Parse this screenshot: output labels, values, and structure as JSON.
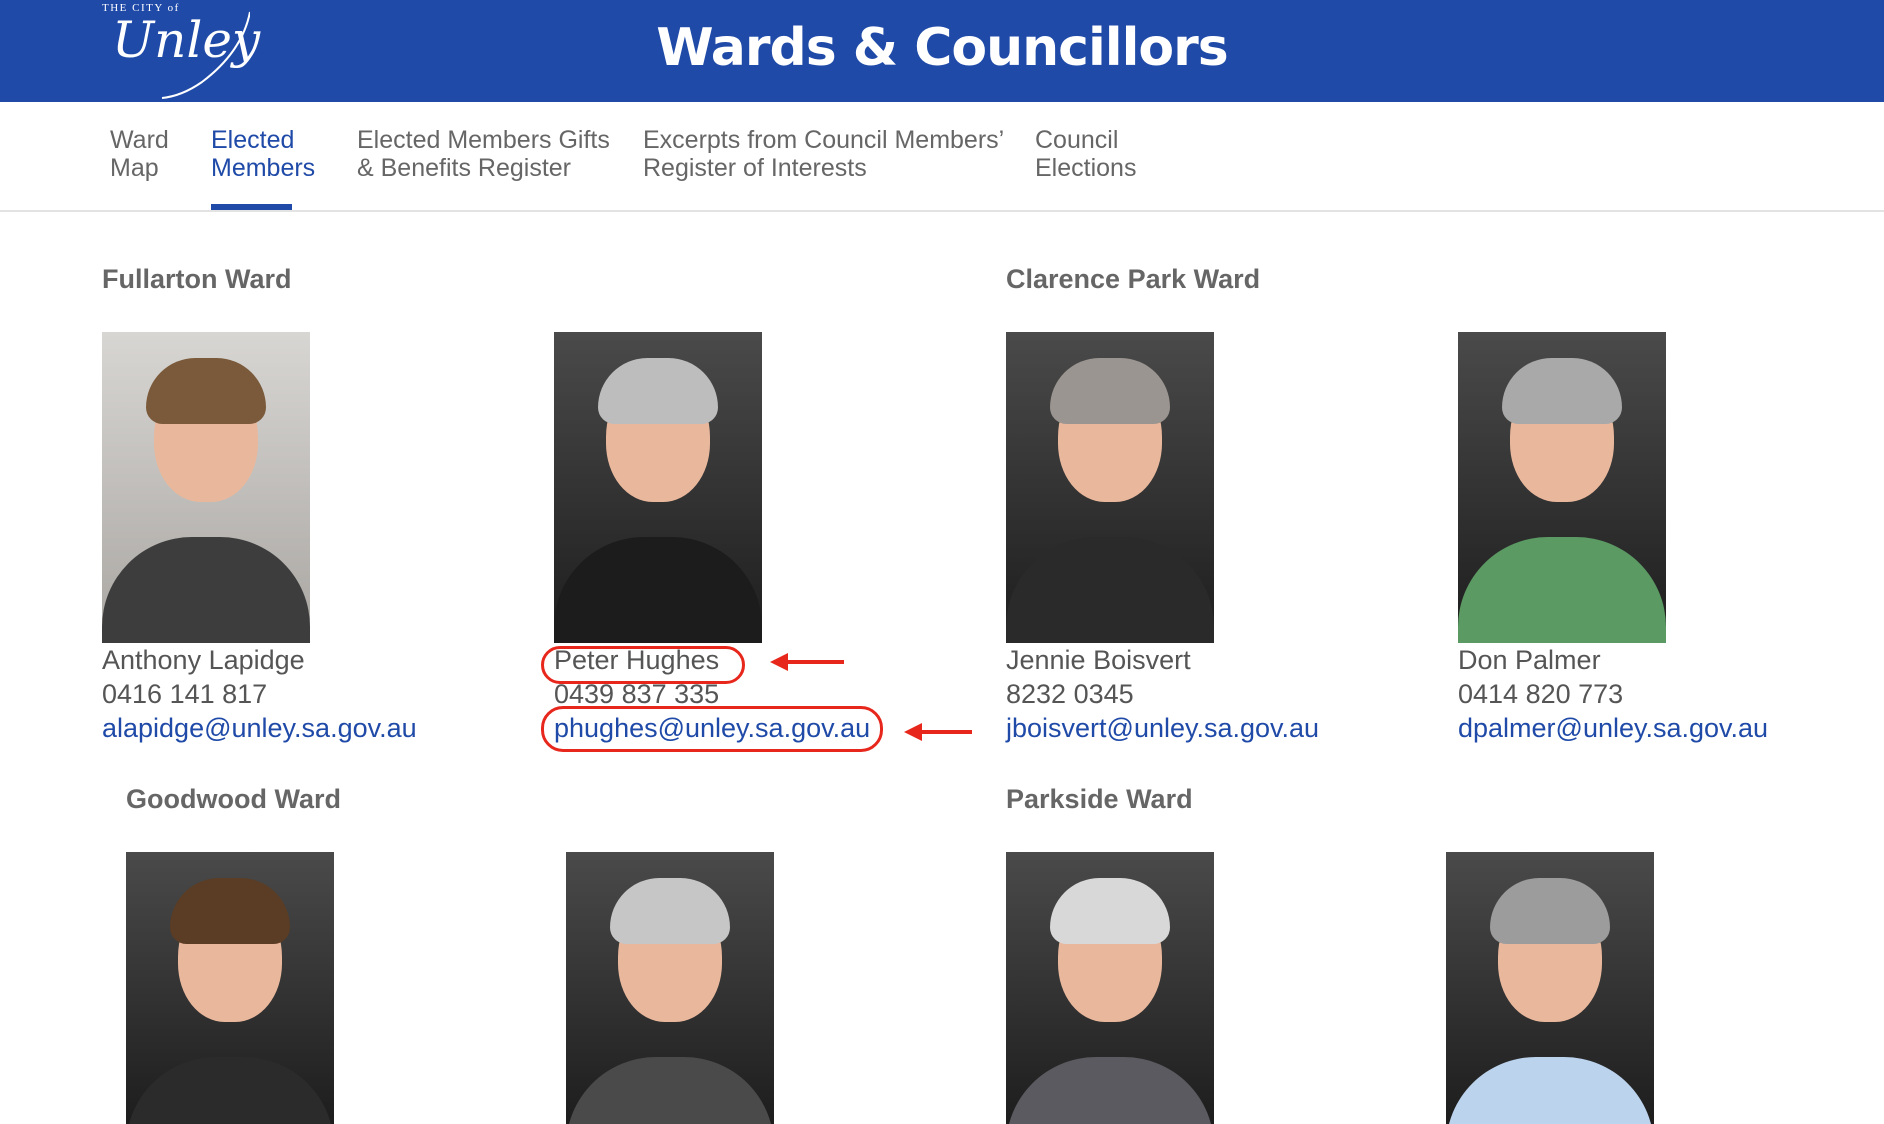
{
  "header": {
    "logo_small": "THE CITY of",
    "logo_script": "Unley",
    "title": "Wards & Councillors"
  },
  "nav": {
    "tabs": [
      {
        "label": "Ward\nMap"
      },
      {
        "label": "Elected\nMembers"
      },
      {
        "label": "Elected Members Gifts\n& Benefits Register"
      },
      {
        "label": "Excerpts from Council Members’\nRegister of Interests"
      },
      {
        "label": "Council\nElections"
      }
    ],
    "active_index": 1
  },
  "wards": [
    {
      "name": "Fullarton Ward",
      "members": [
        {
          "name": "Anthony Lapidge",
          "phone": "0416 141 817",
          "email": "alapidge@unley.sa.gov.au"
        },
        {
          "name": "Peter Hughes",
          "phone": "0439 837 335",
          "email": "phughes@unley.sa.gov.au"
        }
      ]
    },
    {
      "name": "Clarence Park Ward",
      "members": [
        {
          "name": "Jennie Boisvert",
          "phone": "8232 0345",
          "email": "jboisvert@unley.sa.gov.au"
        },
        {
          "name": "Don Palmer",
          "phone": "0414 820 773",
          "email": "dpalmer@unley.sa.gov.au"
        }
      ]
    },
    {
      "name": "Goodwood Ward"
    },
    {
      "name": "Parkside Ward"
    }
  ],
  "colors": {
    "brand": "#1f4aa8",
    "annotation": "#e8271c"
  }
}
